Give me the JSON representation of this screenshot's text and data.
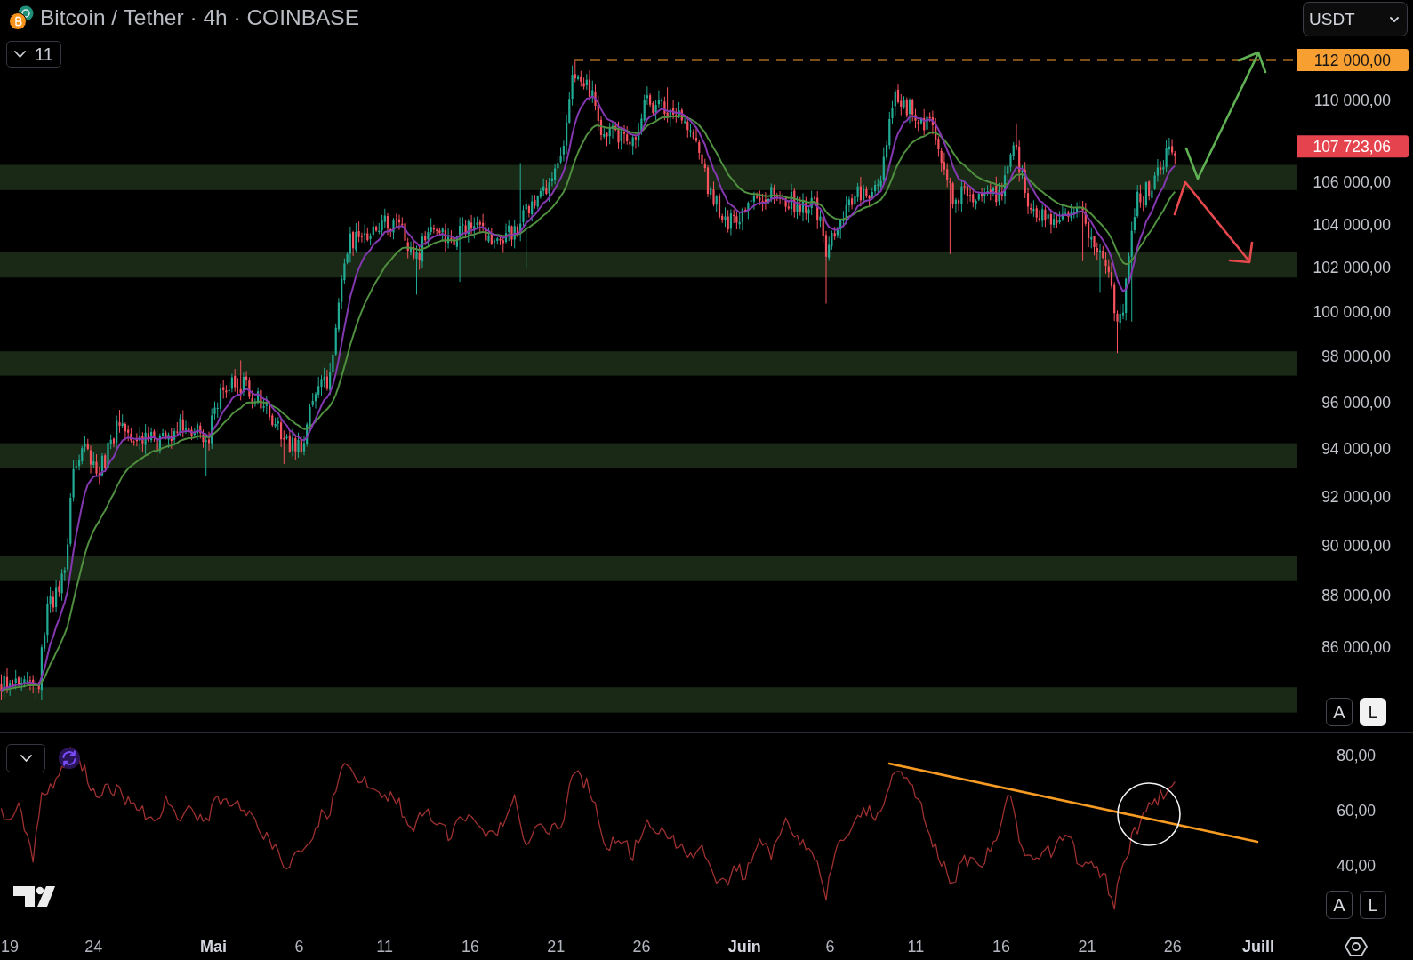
{
  "header": {
    "title": "Bitcoin / Tether · 4h · COINBASE",
    "legend_toggle": {
      "count": "11",
      "expanded": false
    }
  },
  "currency_dropdown": {
    "value": "USDT"
  },
  "price_axis": {
    "labels": [
      {
        "text": "112 000,00",
        "kind": "level"
      },
      {
        "text": "110 000,00",
        "kind": "tick"
      },
      {
        "text": "107 723,06",
        "kind": "last"
      },
      {
        "text": "106 000,00",
        "kind": "tick"
      },
      {
        "text": "104 000,00",
        "kind": "tick"
      },
      {
        "text": "102 000,00",
        "kind": "tick"
      },
      {
        "text": "100 000,00",
        "kind": "tick"
      },
      {
        "text": "98 000,00",
        "kind": "tick"
      },
      {
        "text": "96 000,00",
        "kind": "tick"
      },
      {
        "text": "94 000,00",
        "kind": "tick"
      },
      {
        "text": "92 000,00",
        "kind": "tick"
      },
      {
        "text": "90 000,00",
        "kind": "tick"
      },
      {
        "text": "88 000,00",
        "kind": "tick"
      },
      {
        "text": "86 000,00",
        "kind": "tick"
      }
    ]
  },
  "price_scale_buttons": [
    {
      "label": "A",
      "selected": false
    },
    {
      "label": "L",
      "selected": true
    }
  ],
  "rsi_pane": {
    "toggle": {
      "expanded": false
    },
    "axis_labels": [
      "80,00",
      "60,00",
      "40,00"
    ],
    "scale_buttons": [
      {
        "label": "A",
        "selected": false
      },
      {
        "label": "L",
        "selected": false
      }
    ]
  },
  "time_axis": {
    "labels": [
      {
        "text": "19",
        "kind": "day"
      },
      {
        "text": "24",
        "kind": "day"
      },
      {
        "text": "Mai",
        "kind": "month"
      },
      {
        "text": "6",
        "kind": "day"
      },
      {
        "text": "11",
        "kind": "day"
      },
      {
        "text": "16",
        "kind": "day"
      },
      {
        "text": "21",
        "kind": "day"
      },
      {
        "text": "26",
        "kind": "day"
      },
      {
        "text": "Juin",
        "kind": "month"
      },
      {
        "text": "6",
        "kind": "day"
      },
      {
        "text": "11",
        "kind": "day"
      },
      {
        "text": "16",
        "kind": "day"
      },
      {
        "text": "21",
        "kind": "day"
      },
      {
        "text": "26",
        "kind": "day"
      },
      {
        "text": "Juill",
        "kind": "month"
      }
    ]
  }
}
